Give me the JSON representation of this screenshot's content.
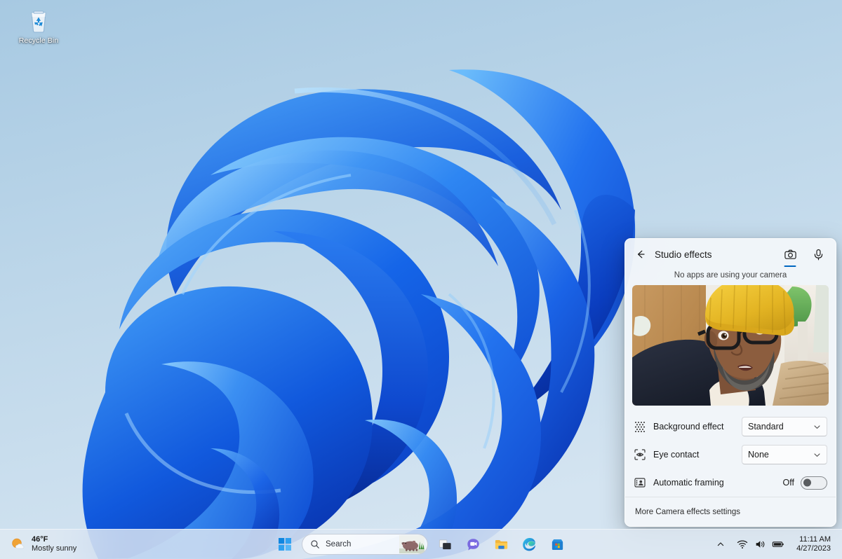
{
  "desktop": {
    "icons": [
      {
        "name": "recycle-bin",
        "label": "Recycle Bin"
      }
    ]
  },
  "studio_effects": {
    "title": "Studio effects",
    "back_label": "Back",
    "tabs": [
      {
        "id": "camera",
        "label": "Camera",
        "icon": "camera-icon",
        "active": true
      },
      {
        "id": "microphone",
        "label": "Microphone",
        "icon": "microphone-icon",
        "active": false
      }
    ],
    "status_text": "No apps are using your camera",
    "preview_alt": "Camera preview",
    "rows": [
      {
        "id": "background-effect",
        "icon": "background-blur-icon",
        "label": "Background effect",
        "control": "dropdown",
        "value": "Standard"
      },
      {
        "id": "eye-contact",
        "icon": "eye-contact-icon",
        "label": "Eye contact",
        "control": "dropdown",
        "value": "None"
      },
      {
        "id": "automatic-framing",
        "icon": "automatic-framing-icon",
        "label": "Automatic framing",
        "control": "toggle",
        "value": "Off",
        "on": false
      }
    ],
    "footer_link": "More Camera effects settings",
    "accent_color": "#0067c0"
  },
  "taskbar": {
    "weather": {
      "temperature": "46°F",
      "condition": "Mostly sunny"
    },
    "start_label": "Start",
    "search": {
      "placeholder": "Search",
      "icon": "search-icon",
      "thumbnail": "hippo-image"
    },
    "apps": [
      {
        "id": "task-view",
        "label": "Task View",
        "icon": "task-view-icon"
      },
      {
        "id": "chat",
        "label": "Chat",
        "icon": "chat-icon"
      },
      {
        "id": "file-explorer",
        "label": "File Explorer",
        "icon": "file-explorer-icon"
      },
      {
        "id": "edge",
        "label": "Microsoft Edge",
        "icon": "edge-icon"
      },
      {
        "id": "microsoft-store",
        "label": "Microsoft Store",
        "icon": "store-icon"
      }
    ],
    "tray": {
      "chevron_label": "Show hidden icons",
      "icons": [
        {
          "id": "network",
          "label": "Network",
          "icon": "wifi-icon"
        },
        {
          "id": "volume",
          "label": "Volume",
          "icon": "speaker-icon"
        },
        {
          "id": "battery",
          "label": "Battery",
          "icon": "battery-icon"
        }
      ]
    },
    "clock": {
      "time": "11:11 AM",
      "date": "4/27/2023"
    }
  }
}
